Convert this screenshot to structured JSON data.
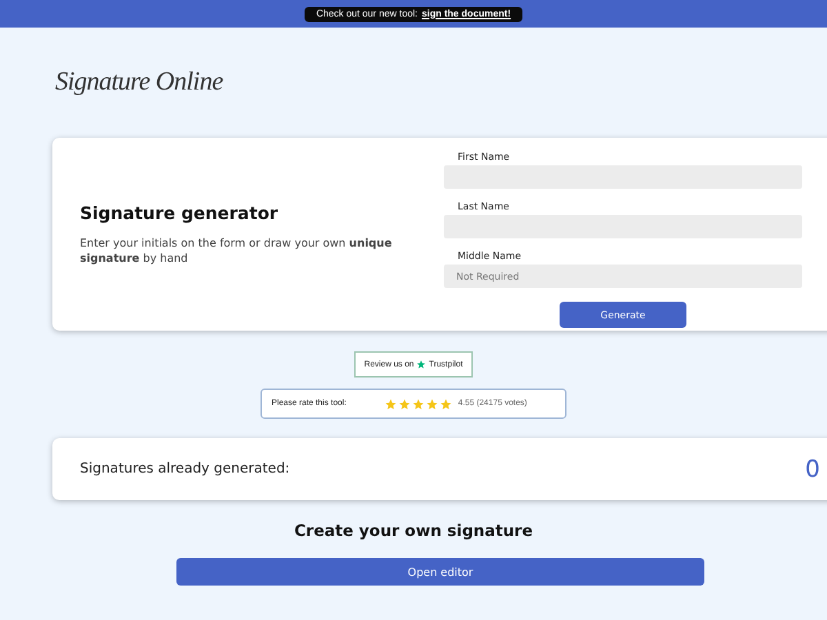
{
  "announcement": {
    "text": "Check out our new tool:",
    "link": "sign the document!"
  },
  "logo": "Signature Online",
  "generator": {
    "title": "Signature generator",
    "description": "Enter your initials on the form or draw your own **unique signature** by hand",
    "fields": [
      {
        "label": "First Name"
      },
      {
        "label": "Last Name"
      },
      {
        "label": "Middle Name",
        "placeholder": "Not Required"
      }
    ],
    "button": "Generate"
  },
  "review": {
    "text": "Review us on",
    "brand": "Trustpilot"
  },
  "rating": {
    "label": "Please rate this tool:",
    "stars": 5,
    "score": "4.55 (24175 votes)"
  },
  "counter": {
    "label": "Signatures already generated:",
    "value": "0"
  },
  "cta": {
    "heading": "Create your own **signature**",
    "button": "Open editor"
  }
}
